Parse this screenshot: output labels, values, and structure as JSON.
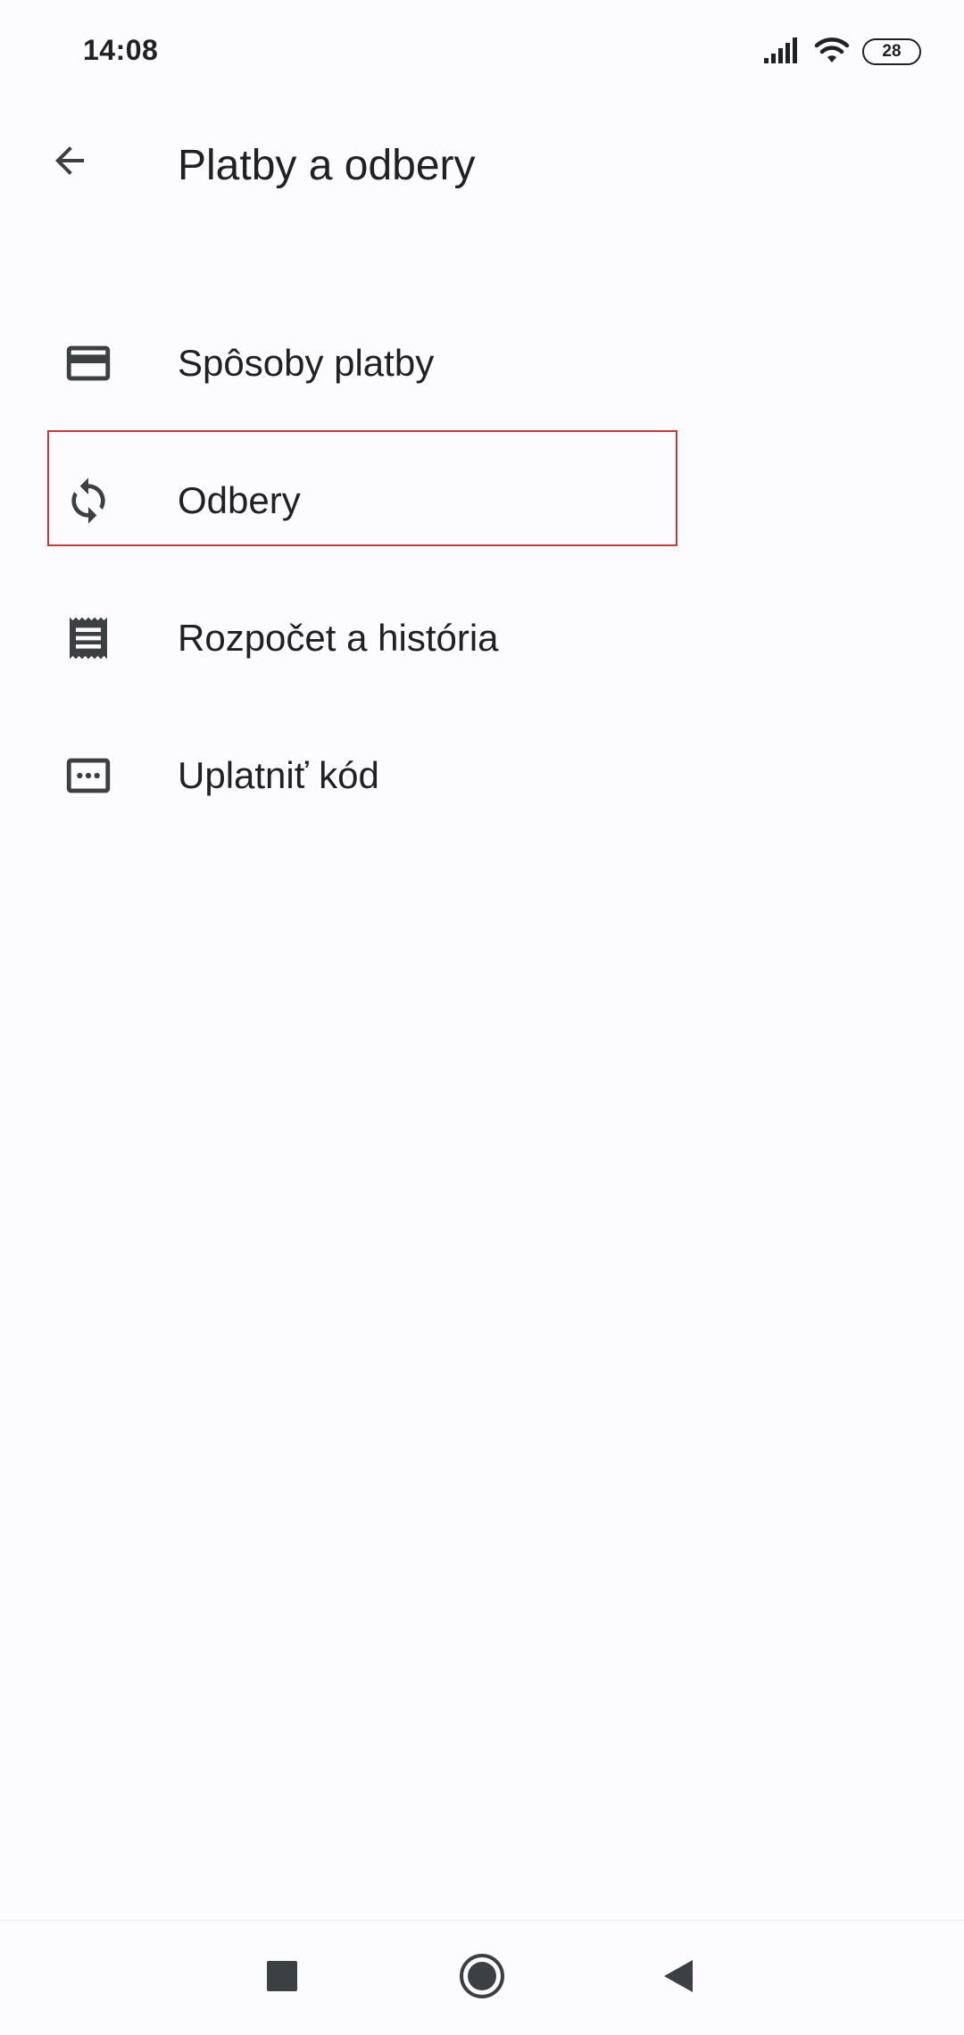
{
  "status_bar": {
    "time": "14:08",
    "battery_level": "28",
    "icons": [
      "signal-icon",
      "wifi-icon",
      "battery-icon"
    ]
  },
  "app_bar": {
    "title": "Platby a odbery",
    "back_icon": "arrow-back-icon"
  },
  "menu": {
    "items": [
      {
        "label": "Spôsoby platby",
        "icon": "credit-card-icon"
      },
      {
        "label": "Odbery",
        "icon": "sync-icon",
        "highlighted": true
      },
      {
        "label": "Rozpočet a história",
        "icon": "receipt-icon"
      },
      {
        "label": "Uplatniť kód",
        "icon": "redeem-code-icon"
      }
    ]
  },
  "nav_bar": {
    "icons": [
      "recents-square-icon",
      "home-circle-icon",
      "back-triangle-icon"
    ]
  },
  "colors": {
    "background": "#fcfcfe",
    "text": "#202124",
    "icon": "#3c4043",
    "highlight_border": "#c8373a"
  }
}
